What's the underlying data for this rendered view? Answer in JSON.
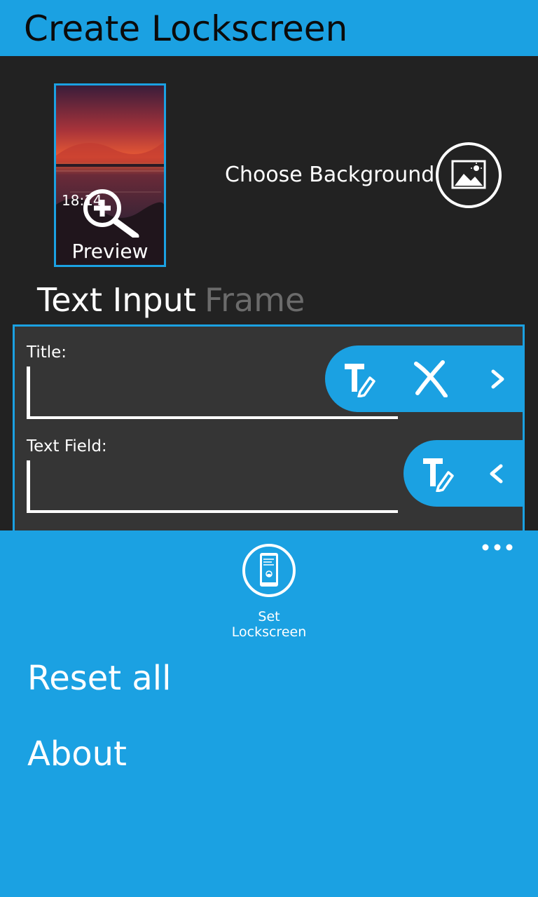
{
  "header": {
    "title": "Create Lockscreen"
  },
  "preview": {
    "time": "18:14",
    "label": "Preview"
  },
  "choose_background": {
    "label": "Choose Background"
  },
  "tabs": [
    {
      "label": "Text Input",
      "active": true
    },
    {
      "label": "Frame",
      "active": false
    }
  ],
  "form": {
    "title_label": "Title:",
    "title_value": "",
    "text_field_label": "Text Field:",
    "text_field_value": ""
  },
  "app_bar": {
    "set_lockscreen_label": "Set\nLockscreen",
    "menu_items": [
      "Reset all",
      "About"
    ]
  },
  "icons": {
    "zoom": "zoom-in-icon",
    "choose_bg": "picture-icon",
    "text_edit": "text-edit-icon",
    "close": "close-icon",
    "next": "chevron-right-icon",
    "prev": "chevron-left-icon",
    "more": "ellipsis-icon",
    "phone": "phone-lock-icon"
  },
  "colors": {
    "accent": "#1ba1e2",
    "background": "#222222",
    "form_background": "#353535",
    "inactive_tab": "#6b6b6b"
  }
}
